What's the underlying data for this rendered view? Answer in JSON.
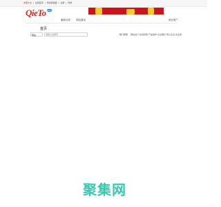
{
  "topbar": {
    "links": [
      "中国大全",
      "设置首页",
      "添加到收藏",
      "注册",
      "登录"
    ],
    "separator": "|"
  },
  "brand": {
    "logo_text": "QieTo",
    "badge": "jieto",
    "accent_color": "#d2261d",
    "banner_color": "#c8141a"
  },
  "nav": {
    "items": [
      "最新动态",
      "网站建设"
    ],
    "right_item": "商业推广"
  },
  "tabs": {
    "home": "首页"
  },
  "search": {
    "category_selected": "网站",
    "placeholder": "请输入关键字"
  },
  "hot_keywords": {
    "label": "热门搜索：",
    "items": [
      "网站设计",
      "在线投稿",
      "产品发布",
      "企业展示",
      "网上企业",
      "企业库"
    ]
  },
  "watermark": {
    "text": "聚集网",
    "color": "#3ec7b0"
  }
}
